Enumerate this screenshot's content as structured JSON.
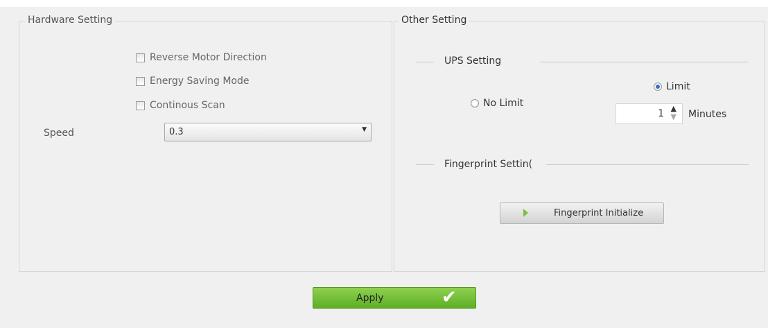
{
  "hardware": {
    "title": "Hardware Setting",
    "options": [
      {
        "label": "Reverse Motor Direction",
        "checked": false
      },
      {
        "label": "Energy Saving Mode",
        "checked": false
      },
      {
        "label": "Continous Scan",
        "checked": false
      }
    ],
    "speed_label": "Speed",
    "speed_value": "0.3",
    "speed_caret": "▼"
  },
  "other": {
    "title": "Other Setting",
    "ups": {
      "title": "UPS Setting",
      "no_limit_label": "No Limit",
      "limit_label": "Limit",
      "selected": "Limit",
      "minutes_value": "1",
      "minutes_label": "Minutes",
      "spin_up": "▲",
      "spin_down": "▼"
    },
    "fingerprint": {
      "title": "Fingerprint Settin(",
      "button_label": "Fingerprint Initialize",
      "button_icon": "fingerprint-icon"
    }
  },
  "footer": {
    "apply_label": "Apply",
    "apply_icon": "checkmark-icon",
    "apply_check": "✔"
  },
  "colors": {
    "apply_green": "#6cbf2f",
    "radio_selected": "#3a6fc4"
  }
}
